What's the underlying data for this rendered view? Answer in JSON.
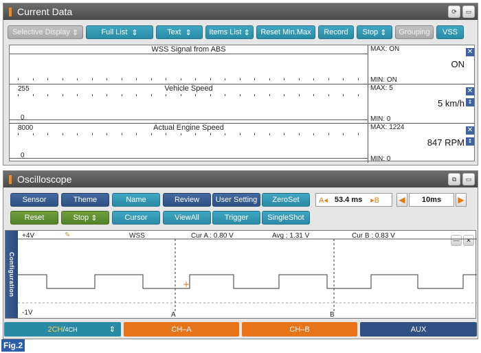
{
  "current_data": {
    "title": "Current Data",
    "toolbar": [
      "Selective Display",
      "Full List",
      "Text",
      "Items List",
      "Reset Min.Max",
      "Record",
      "Stop",
      "Grouping",
      "VSS"
    ],
    "rows": [
      {
        "name": "WSS Signal from ABS",
        "ymax": "",
        "ymin": "",
        "max": "MAX: ON",
        "min": "MIN: ON",
        "value": "ON"
      },
      {
        "name": "Vehicle Speed",
        "ymax": "255",
        "ymin": "0",
        "max": "MAX: 5",
        "min": "MIN: 0",
        "value": "5 km/h"
      },
      {
        "name": "Actual Engine Speed",
        "ymax": "8000",
        "ymin": "0",
        "max": "MAX: 1224",
        "min": "MIN: 0",
        "value": "847 RPM"
      }
    ]
  },
  "oscilloscope": {
    "title": "Oscilloscope",
    "row1": [
      "Sensor",
      "Theme",
      "Name",
      "Review",
      "User Setting",
      "ZeroSet"
    ],
    "row2": [
      "Reset",
      "Stop",
      "Cursor",
      "ViewAll",
      "Trigger",
      "SingleShot"
    ],
    "a_label": "A",
    "b_label": "B",
    "delta": "53.4 ms",
    "timebase": "10ms",
    "config_label": "Configuration",
    "top_v": "+4V",
    "bottom_v": "-1V",
    "channel_name": "WSS",
    "cur_a": "Cur A : 0.80 V",
    "avg": "Avg : 1.31 V",
    "cur_b": "Cur B : 0.83 V",
    "cursor_a": "A",
    "cursor_b": "B"
  },
  "bottom_bar": {
    "ch2": "2CH",
    "ch4": "4CH",
    "cha": "CH–A",
    "chb": "CH–B",
    "aux": "AUX"
  },
  "figure_label": "Fig.2",
  "colors": {
    "teal": "#2a8ba6",
    "navy": "#2f5184",
    "green": "#54822a",
    "orange": "#e8741a",
    "titlebar": "#555555"
  },
  "icons": [
    "retry-icon",
    "restore-icon",
    "close-icon",
    "updown-icon",
    "left-arrow-icon",
    "right-arrow-icon",
    "probe-icon"
  ]
}
